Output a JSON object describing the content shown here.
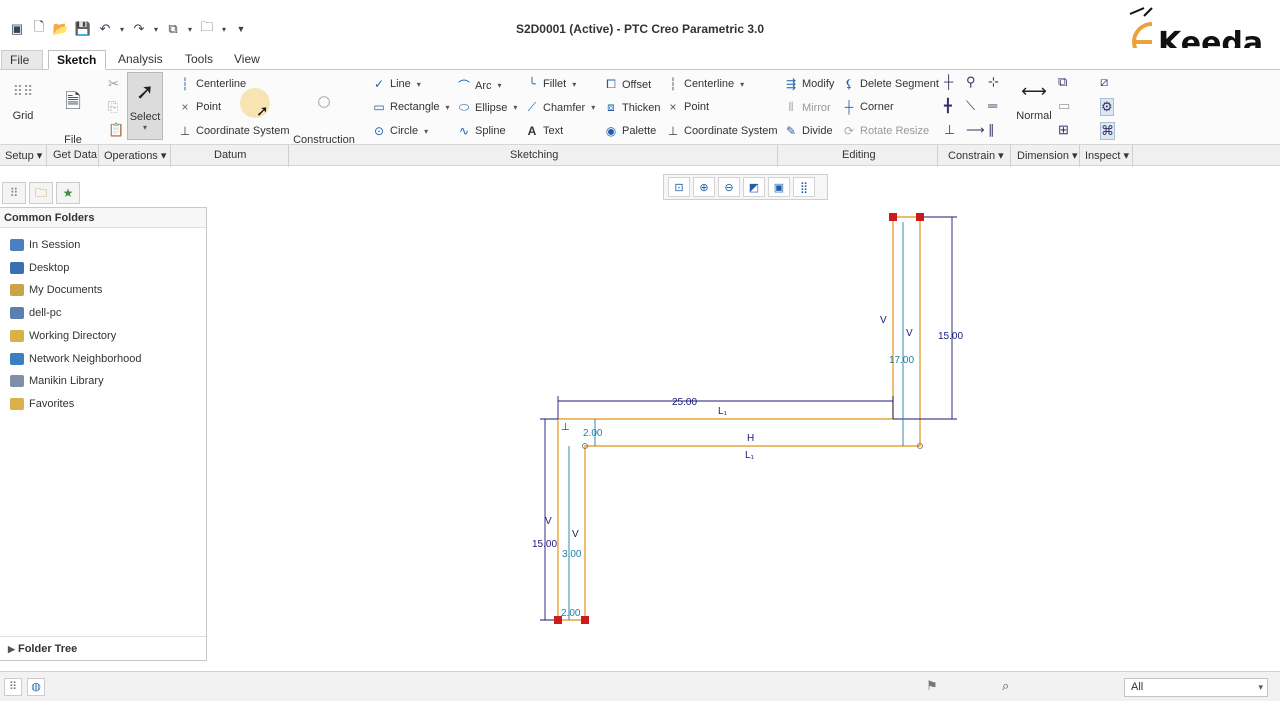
{
  "window": {
    "title": "S2D0001 (Active) - PTC Creo Parametric 3.0"
  },
  "logo": {
    "text": "Keeda"
  },
  "tabs": [
    {
      "label": "File",
      "dropdown": "▾"
    },
    {
      "label": "Sketch"
    },
    {
      "label": "Analysis"
    },
    {
      "label": "Tools"
    },
    {
      "label": "View"
    }
  ],
  "ribbon": {
    "grid": "Grid",
    "file_system": "File\nSystem",
    "select": "Select",
    "datum": {
      "centerline": "Centerline",
      "point": "Point",
      "coordinate_system": "Coordinate System"
    },
    "construction_mode": "Construction\nMode",
    "sketching": {
      "line": "Line",
      "rectangle": "Rectangle",
      "circle": "Circle",
      "arc": "Arc",
      "ellipse": "Ellipse",
      "spline": "Spline",
      "fillet": "Fillet",
      "chamfer": "Chamfer",
      "text": "Text",
      "offset": "Offset",
      "thicken": "Thicken",
      "palette": "Palette",
      "centerline": "Centerline",
      "point": "Point",
      "coordinate_system": "Coordinate System"
    },
    "editing": {
      "modify": "Modify",
      "delete_segment": "Delete Segment",
      "mirror": "Mirror",
      "corner": "Corner",
      "divide": "Divide",
      "rotate_resize": "Rotate Resize"
    },
    "normal": "Normal",
    "groups": [
      "Setup",
      "Get Data",
      "Operations",
      "Datum",
      "Sketching",
      "Editing",
      "Constrain",
      "Dimension",
      "Inspect"
    ]
  },
  "folders": {
    "header": "Common Folders",
    "items": [
      {
        "label": "In Session",
        "icon": "monitor-icon",
        "color": "#4a7fc0"
      },
      {
        "label": "Desktop",
        "icon": "desktop-icon",
        "color": "#3a6fb0"
      },
      {
        "label": "My Documents",
        "icon": "documents-icon",
        "color": "#c9a24a"
      },
      {
        "label": "dell-pc",
        "icon": "computer-icon",
        "color": "#5a7fb0"
      },
      {
        "label": "Working Directory",
        "icon": "working-directory-icon",
        "color": "#d9b04a"
      },
      {
        "label": "Network Neighborhood",
        "icon": "network-icon",
        "color": "#3a80c0"
      },
      {
        "label": "Manikin Library",
        "icon": "library-icon",
        "color": "#7f8fa8"
      },
      {
        "label": "Favorites",
        "icon": "favorites-icon",
        "color": "#d9b04a"
      }
    ],
    "tree": "Folder Tree"
  },
  "sketch": {
    "dims": {
      "top_width": "25.00",
      "right_height": "15.00",
      "right_inner": "17.00",
      "left_height": "15.00",
      "left_inner": "3.00",
      "thickness_top": "2.00",
      "thickness_bottom": "2.00"
    },
    "constraints": {
      "v": "V",
      "h": "H",
      "perp": "⊥",
      "l1": "L₁"
    },
    "colors": {
      "geometry": "#e8a33a",
      "dimension": "#1a1a7a",
      "strong_dim": "#1e7fa8",
      "point": "#cc1b1b"
    }
  },
  "status": {
    "filter": "All"
  }
}
